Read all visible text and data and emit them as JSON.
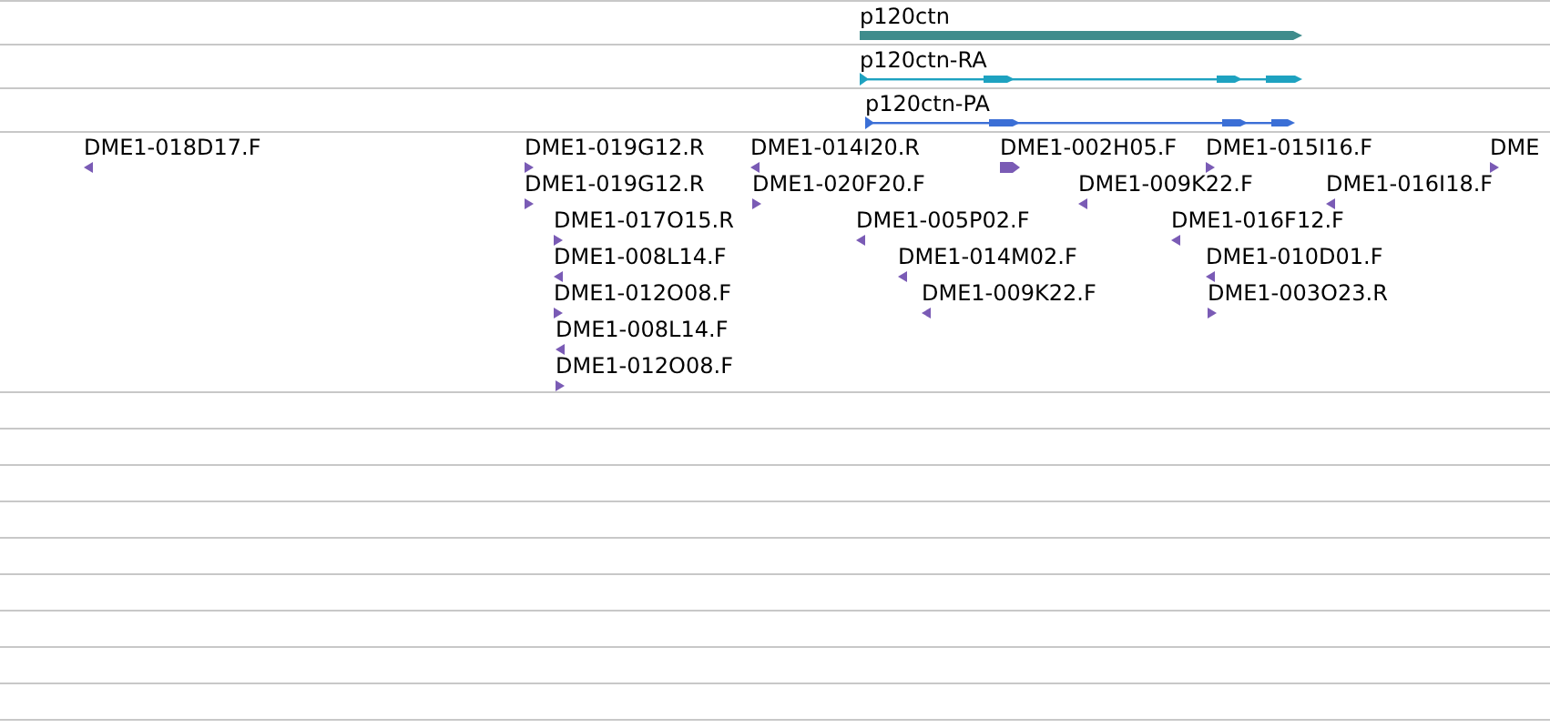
{
  "gene_track": {
    "features": [
      {
        "label": "p120ctn",
        "kind": "gene"
      },
      {
        "label": "p120ctn-RA",
        "kind": "transcript"
      },
      {
        "label": "p120ctn-PA",
        "kind": "protein"
      }
    ]
  },
  "reads_track": {
    "reads": [
      {
        "label": "DME1-018D17.F",
        "reverse": true
      },
      {
        "label": "DME1-019G12.R",
        "reverse": false
      },
      {
        "label": "DME1-014I20.R",
        "reverse": true
      },
      {
        "label": "DME1-002H05.F",
        "reverse": false
      },
      {
        "label": "DME1-015I16.F",
        "reverse": false
      },
      {
        "label": "DME",
        "reverse": false
      },
      {
        "label": "DME1-019G12.R",
        "reverse": false
      },
      {
        "label": "DME1-020F20.F",
        "reverse": false
      },
      {
        "label": "DME1-009K22.F",
        "reverse": true
      },
      {
        "label": "DME1-016I18.F",
        "reverse": true
      },
      {
        "label": "DME1-017O15.R",
        "reverse": false
      },
      {
        "label": "DME1-005P02.F",
        "reverse": true
      },
      {
        "label": "DME1-016F12.F",
        "reverse": true
      },
      {
        "label": "DME1-008L14.F",
        "reverse": true
      },
      {
        "label": "DME1-014M02.F",
        "reverse": true
      },
      {
        "label": "DME1-010D01.F",
        "reverse": true
      },
      {
        "label": "DME1-012O08.F",
        "reverse": false
      },
      {
        "label": "DME1-009K22.F",
        "reverse": true
      },
      {
        "label": "DME1-003O23.R",
        "reverse": false
      },
      {
        "label": "DME1-008L14.F",
        "reverse": true
      },
      {
        "label": "DME1-012O08.F",
        "reverse": false
      }
    ]
  }
}
